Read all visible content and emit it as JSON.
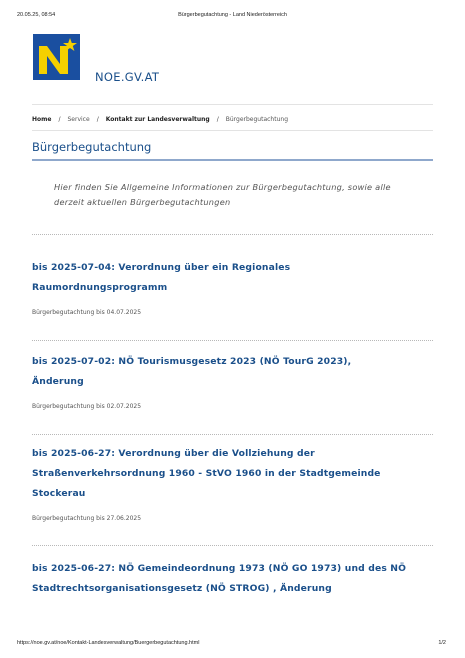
{
  "print_header": {
    "datetime": "20.05.25, 08:54",
    "page_title": "Bürgerbegutachtung - Land Niederösterreich"
  },
  "site": {
    "name": "NOE.GV.AT",
    "logo_colors": {
      "background": "#1a4fa0",
      "mark": "#f5d000"
    }
  },
  "breadcrumb": {
    "items": [
      "Home",
      "Service",
      "Kontakt zur Landesverwaltung",
      "Bürgerbegutachtung"
    ],
    "separator": "/"
  },
  "page": {
    "title": "Bürgerbegutachtung",
    "intro": "Hier finden Sie Allgemeine Informationen zur Bürgerbegutachtung, sowie alle derzeit aktuellen Bürgerbegutachtungen"
  },
  "items": [
    {
      "title_line1": "bis 2025-07-04: Verordnung über ein Regionales",
      "title_line2": "Raumordnungsprogramm",
      "meta": "Bürgerbegutachtung bis 04.07.2025"
    },
    {
      "title_line1": "bis 2025-07-02: NÖ Tourismusgesetz 2023 (NÖ TourG 2023),",
      "title_line2": "Änderung",
      "meta": "Bürgerbegutachtung bis 02.07.2025"
    },
    {
      "title_line1": "bis 2025-06-27: Verordnung über die Vollziehung der",
      "title_line2": "Straßenverkehrsordnung 1960 - StVO 1960 in der Stadtgemeinde",
      "title_line3": "Stockerau",
      "meta": "Bürgerbegutachtung bis 27.06.2025"
    },
    {
      "title_line1": "bis 2025-06-27: NÖ Gemeindeordnung 1973 (NÖ GO 1973) und des NÖ",
      "title_line2": "Stadtrechtsorganisationsgesetz (NÖ STROG) , Änderung"
    }
  ],
  "print_footer": {
    "url": "https://noe.gv.at/noe/Kontakt-Landesverwaltung/Buergerbegutachtung.html",
    "page": "1/2"
  }
}
